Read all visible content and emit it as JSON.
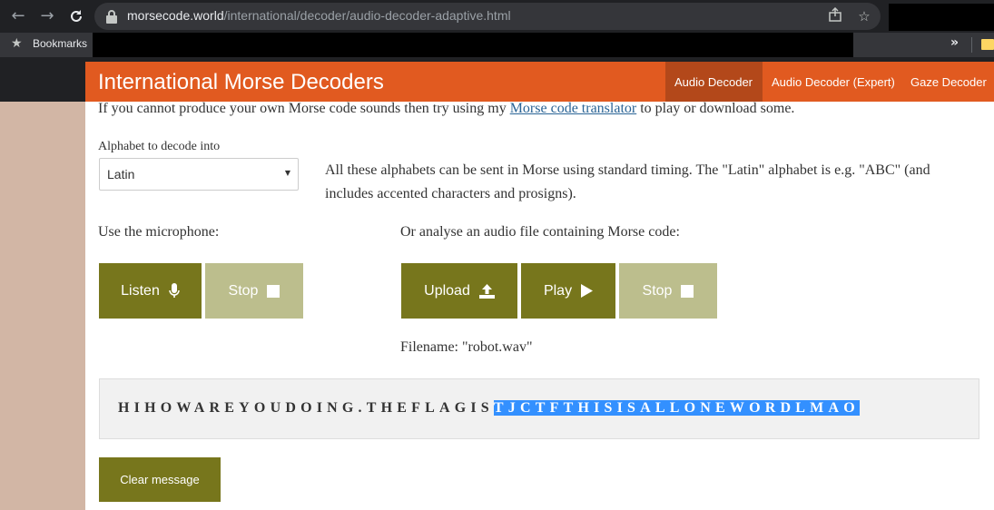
{
  "browser": {
    "url_host": "morsecode.world",
    "url_path": "/international/decoder/audio-decoder-adaptive.html",
    "bookmarks_label": "Bookmarks",
    "more_label": "»"
  },
  "header": {
    "title": "International Morse Decoders",
    "tabs": [
      {
        "label": "Audio Decoder",
        "active": true
      },
      {
        "label": "Audio Decoder (Expert)",
        "active": false
      },
      {
        "label": "Gaze Decoder",
        "active": false
      }
    ],
    "accent": "#e15a20"
  },
  "intro": {
    "before": "If you cannot produce your own Morse code sounds then try using my ",
    "link": "Morse code translator",
    "after": " to play or download some."
  },
  "alphabet": {
    "label": "Alphabet to decode into",
    "selected": "Latin",
    "description": "All these alphabets can be sent in Morse using standard timing. The \"Latin\" alphabet is e.g. \"ABC\" (and includes accented characters and prosigns)."
  },
  "microphone": {
    "label": "Use the microphone:",
    "listen_label": "Listen",
    "stop_label": "Stop"
  },
  "audio_file": {
    "label": "Or analyse an audio file containing Morse code:",
    "upload_label": "Upload",
    "play_label": "Play",
    "stop_label": "Stop",
    "filename_text": "Filename: \"robot.wav\""
  },
  "message": {
    "plain": "HIHOWAREYOUDOING.THEFLAGIS",
    "selected": "TJCTFTHISISALLONEWORDLMAO"
  },
  "clear_label": "Clear message",
  "colors": {
    "button_dark": "#77761c",
    "button_light": "#bcbe8d",
    "selection": "#3390ff"
  }
}
